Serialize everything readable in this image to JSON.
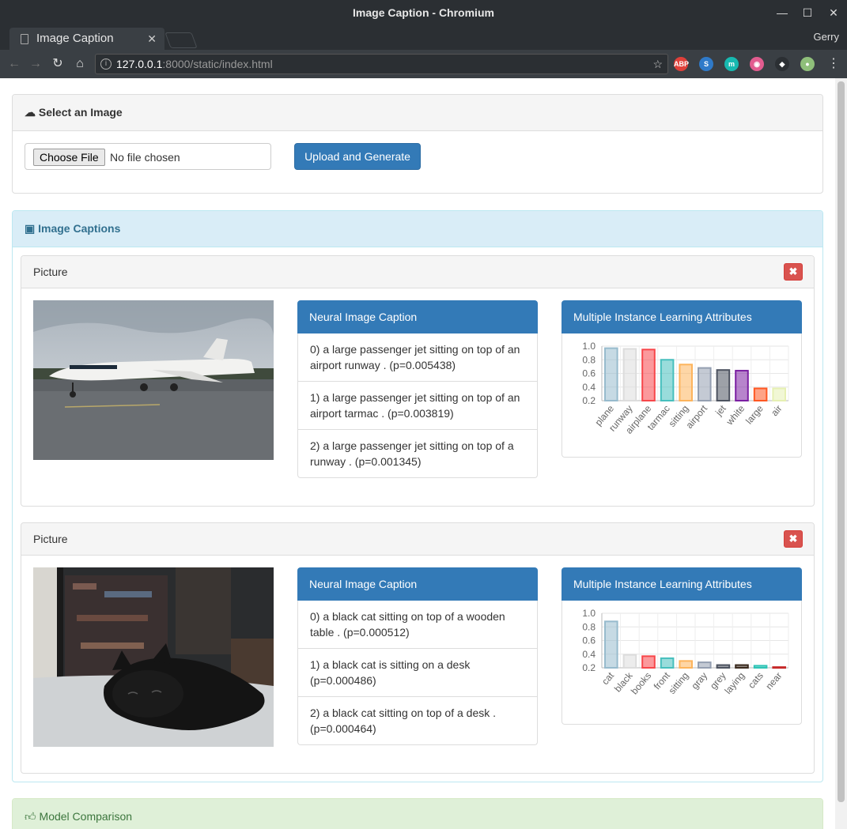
{
  "browser": {
    "window_title": "Image Caption - Chromium",
    "tab_title": "Image Caption",
    "profile_name": "Gerry",
    "url_host": "127.0.0.1",
    "url_rest": ":8000/static/index.html",
    "extensions": [
      {
        "name": "adblock-plus-icon",
        "label": "ABP",
        "color": "#e0403a"
      },
      {
        "name": "s-extension-icon",
        "label": "S",
        "color": "#2f7ac9"
      },
      {
        "name": "m-extension-icon",
        "label": "m",
        "color": "#17b9b0"
      },
      {
        "name": "octocat-icon",
        "label": "◉",
        "color": "#e25c8f"
      },
      {
        "name": "gnome-icon",
        "label": "◆",
        "color": "#2b2f33"
      },
      {
        "name": "avatar-icon",
        "label": "●",
        "color": "#8fbf7a"
      }
    ]
  },
  "upload": {
    "heading": "Select an Image",
    "choose_label": "Choose File",
    "no_file": "No file chosen",
    "submit": "Upload and Generate"
  },
  "captions": {
    "heading": "Image Captions",
    "pictures": [
      {
        "title": "Picture",
        "nic_heading": "Neural Image Caption",
        "captions": [
          "0) a large passenger jet sitting on top of an airport runway . (p=0.005438)",
          "1) a large passenger jet sitting on top of an airport tarmac . (p=0.003819)",
          "2) a large passenger jet sitting on top of a runway . (p=0.001345)"
        ],
        "mil_heading": "Multiple Instance Learning Attributes"
      },
      {
        "title": "Picture",
        "nic_heading": "Neural Image Caption",
        "captions": [
          "0) a black cat sitting on top of a wooden table . (p=0.000512)",
          "1) a black cat is sitting on a desk (p=0.000486)",
          "2) a black cat sitting on top of a desk . (p=0.000464)"
        ],
        "mil_heading": "Multiple Instance Learning Attributes"
      }
    ]
  },
  "comparison": {
    "heading": "Model Comparison"
  },
  "chart_data": [
    {
      "type": "bar",
      "categories": [
        "plane",
        "runway",
        "airplane",
        "tarmac",
        "sitting",
        "airport",
        "jet",
        "white",
        "large",
        "air"
      ],
      "values": [
        0.97,
        0.96,
        0.95,
        0.8,
        0.73,
        0.68,
        0.65,
        0.64,
        0.38,
        0.38
      ],
      "colors": [
        "#97bbcd",
        "#dcdcdc",
        "#f7464a",
        "#46bfbd",
        "#fdb45c",
        "#949fb1",
        "#4d5360",
        "#7b1fa2",
        "#fe5722",
        "#e6f0b3"
      ],
      "yticks": [
        "1.0",
        "0.8",
        "0.6",
        "0.4",
        "0.2"
      ],
      "ylim": [
        0.2,
        1.0
      ],
      "grid": true
    },
    {
      "type": "bar",
      "categories": [
        "cat",
        "black",
        "books",
        "front",
        "sitting",
        "gray",
        "grey",
        "laying",
        "cats",
        "near"
      ],
      "values": [
        0.88,
        0.39,
        0.37,
        0.34,
        0.3,
        0.28,
        0.24,
        0.24,
        0.23,
        0.21
      ],
      "colors": [
        "#97bbcd",
        "#dcdcdc",
        "#f7464a",
        "#46bfbd",
        "#fdb45c",
        "#949fb1",
        "#4d5360",
        "#3a2a1e",
        "#2ec4b6",
        "#c62828"
      ],
      "yticks": [
        "1.0",
        "0.8",
        "0.6",
        "0.4",
        "0.2"
      ],
      "ylim": [
        0.2,
        1.0
      ],
      "grid": true
    }
  ]
}
